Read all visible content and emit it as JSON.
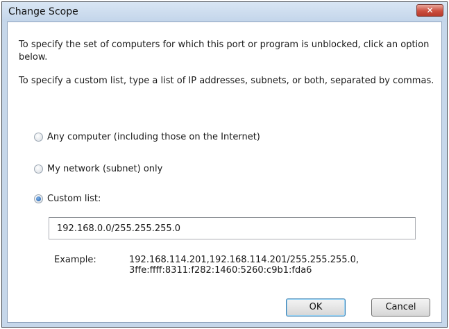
{
  "window": {
    "title": "Change Scope",
    "close_label": "✕"
  },
  "body": {
    "para1": "To specify the set of computers for which this port or program is unblocked, click an option below.",
    "para2": "To specify a custom list, type a list of IP addresses, subnets, or both, separated by commas."
  },
  "options": [
    {
      "label": "Any computer (including those on the Internet)",
      "checked": false
    },
    {
      "label": "My network (subnet) only",
      "checked": false
    },
    {
      "label": "Custom list:",
      "checked": true
    }
  ],
  "custom_list": {
    "value": "192.168.0.0/255.255.255.0"
  },
  "example": {
    "label": "Example:",
    "text": "192.168.114.201,192.168.114.201/255.255.255.0,\n3ffe:ffff:8311:f282:1460:5260:c9b1:fda6"
  },
  "buttons": {
    "ok": "OK",
    "cancel": "Cancel"
  }
}
